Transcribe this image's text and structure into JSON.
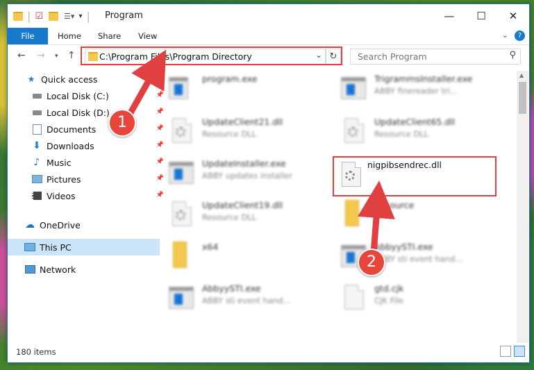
{
  "window": {
    "title": "Program"
  },
  "ribbon": {
    "tabs": [
      "File",
      "Home",
      "Share",
      "View"
    ]
  },
  "address": {
    "path": "C:\\Program Files\\Program Directory"
  },
  "search": {
    "placeholder": "Search Program"
  },
  "sidebar": {
    "items": [
      {
        "label": "Quick access",
        "icon": "star-icon"
      },
      {
        "label": "Local Disk (C:)",
        "icon": "drive-icon"
      },
      {
        "label": "Local Disk (D:)",
        "icon": "drive-icon"
      },
      {
        "label": "Documents",
        "icon": "documents-icon"
      },
      {
        "label": "Downloads",
        "icon": "download-icon"
      },
      {
        "label": "Music",
        "icon": "music-icon"
      },
      {
        "label": "Pictures",
        "icon": "pictures-icon"
      },
      {
        "label": "Videos",
        "icon": "videos-icon"
      },
      {
        "label": "OneDrive",
        "icon": "cloud-icon"
      },
      {
        "label": "This PC",
        "icon": "computer-icon"
      },
      {
        "label": "Network",
        "icon": "network-icon"
      }
    ]
  },
  "files": [
    {
      "name": "program.exe",
      "desc": ""
    },
    {
      "name": "TrigrammsInstaller.exe",
      "desc": "ABBY finereader tri..."
    },
    {
      "name": "UpdateClient21.dll",
      "desc": "Resource DLL"
    },
    {
      "name": "UpdateClient65.dll",
      "desc": "Resource DLL"
    },
    {
      "name": "UpdateInstaller.exe",
      "desc": "ABBY updates installer"
    },
    {
      "name": "nigpibsendrec.dll",
      "desc": ""
    },
    {
      "name": "UpdateClient19.dll",
      "desc": "Resource DLL"
    },
    {
      "name": "Resource",
      "desc": ""
    },
    {
      "name": "x64",
      "desc": ""
    },
    {
      "name": "AbbyySTI.exe",
      "desc": "ABBY sti event hand..."
    },
    {
      "name": "AbbyySTI.exe",
      "desc": "ABBY sti event hand..."
    },
    {
      "name": "gtd.cjk",
      "desc": "CJK File"
    }
  ],
  "status": {
    "count": "180 items"
  },
  "annotations": {
    "step1": "1",
    "step2": "2",
    "color": "#e04040"
  }
}
